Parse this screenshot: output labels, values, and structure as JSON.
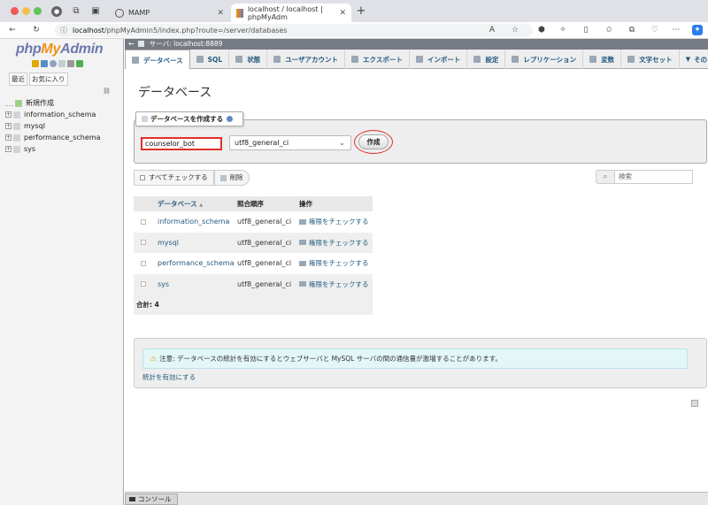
{
  "browser": {
    "tabs": [
      {
        "title": "MAMP",
        "active": false
      },
      {
        "title": "localhost / localhost | phpMyAdm",
        "active": true
      }
    ],
    "url_host": "localhost",
    "url_path": "/phpMyAdmin5/index.php?route=/server/databases"
  },
  "sidebar": {
    "logo_php": "php",
    "logo_my": "My",
    "logo_admin": "Admin",
    "tab_recent": "最近",
    "tab_favorites": "お気に入り",
    "link_icon": "chain-link-icon",
    "tree": [
      {
        "label": "新規作成"
      },
      {
        "label": "information_schema"
      },
      {
        "label": "mysql"
      },
      {
        "label": "performance_schema"
      },
      {
        "label": "sys"
      }
    ]
  },
  "serverbar": {
    "label": "サーバ: localhost:8889"
  },
  "menu": [
    {
      "label": "データベース",
      "active": true
    },
    {
      "label": "SQL"
    },
    {
      "label": "状態"
    },
    {
      "label": "ユーザアカウント"
    },
    {
      "label": "エクスポート"
    },
    {
      "label": "インポート"
    },
    {
      "label": "設定"
    },
    {
      "label": "レプリケーション"
    },
    {
      "label": "変数"
    },
    {
      "label": "文字セット"
    },
    {
      "label": "その"
    }
  ],
  "main": {
    "title": "データベース",
    "create_legend": "データベースを作成する",
    "db_name_value": "counselor_bot",
    "collation_value": "utf8_general_ci",
    "create_button": "作成",
    "check_all": "すべてチェックする",
    "delete": "削除",
    "search_placeholder": "検索",
    "table_headers": {
      "database": "データベース",
      "sort": "▲",
      "collation": "照合順序",
      "actions": "操作"
    },
    "databases": [
      {
        "name": "information_schema",
        "collation": "utf8_general_ci",
        "action": "権限をチェックする"
      },
      {
        "name": "mysql",
        "collation": "utf8_general_ci",
        "action": "権限をチェックする"
      },
      {
        "name": "performance_schema",
        "collation": "utf8_general_ci",
        "action": "権限をチェックする"
      },
      {
        "name": "sys",
        "collation": "utf8_general_ci",
        "action": "権限をチェックする"
      }
    ],
    "total": "合計: 4",
    "notice": "注意: データベースの統計を有効にするとウェブサーバと MySQL サーバの間の通信量が激増することがあります。",
    "enable_stats": "統計を有効にする"
  },
  "console": {
    "label": "コンソール"
  },
  "colors": {
    "accent_red": "#e0302a",
    "link_blue": "#235a81",
    "logo_blue": "#6c78af",
    "logo_orange": "#f29111"
  }
}
